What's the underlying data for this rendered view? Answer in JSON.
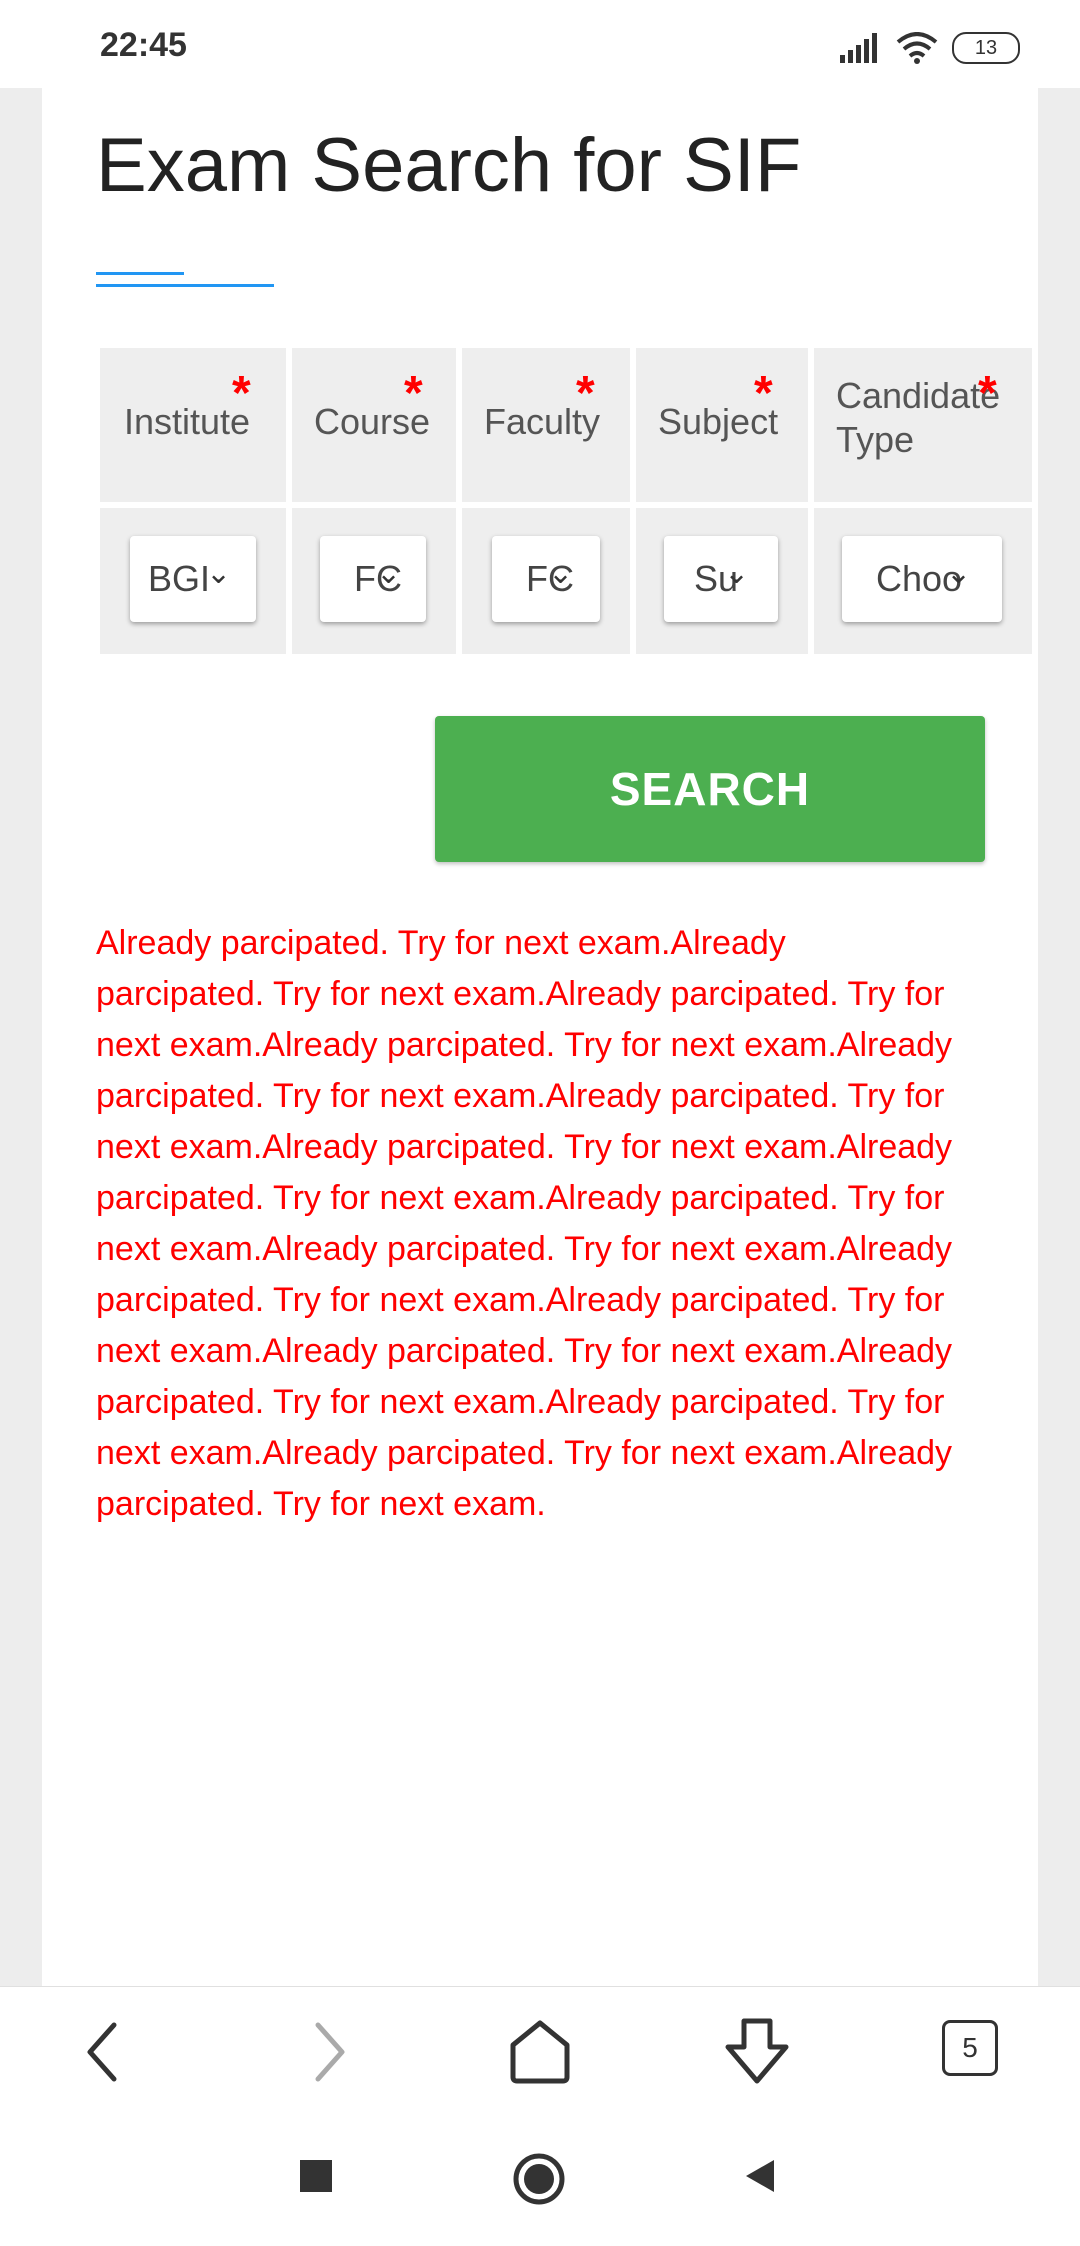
{
  "status_bar": {
    "time": "22:45",
    "battery": "13"
  },
  "page": {
    "title": "Exam Search for SIF"
  },
  "filters": [
    {
      "label": "Institute",
      "value": "BGI",
      "required": true
    },
    {
      "label": "Course",
      "value": "FC",
      "required": true
    },
    {
      "label": "Faculty",
      "value": "FC",
      "required": true
    },
    {
      "label": "Subject",
      "value": "Su",
      "required": true
    },
    {
      "label": "Candidate Type",
      "label_line1": "Candidate",
      "label_line2": "Type",
      "value": "Choo",
      "required": true
    }
  ],
  "required_marker": "*",
  "search_button": {
    "label": "SEARCH"
  },
  "error_message": "Already parcipated. Try for next exam.Already parcipated. Try for next exam.Already parcipated. Try for next exam.Already parcipated. Try for next exam.Already parcipated. Try for next exam.Already parcipated. Try for next exam.Already parcipated. Try for next exam.Already parcipated. Try for next exam.Already parcipated. Try for next exam.Already parcipated. Try for next exam.Already parcipated. Try for next exam.Already parcipated. Try for next exam.Already parcipated. Try for next exam.Already parcipated. Try for next exam.Already parcipated. Try for next exam.Already parcipated. Try for next exam.Already parcipated. Try for next exam.",
  "browser_nav": {
    "tab_count": "5"
  },
  "colors": {
    "accent_green": "#4caf50",
    "error_red": "#ff0000",
    "link_blue": "#2196f3"
  }
}
